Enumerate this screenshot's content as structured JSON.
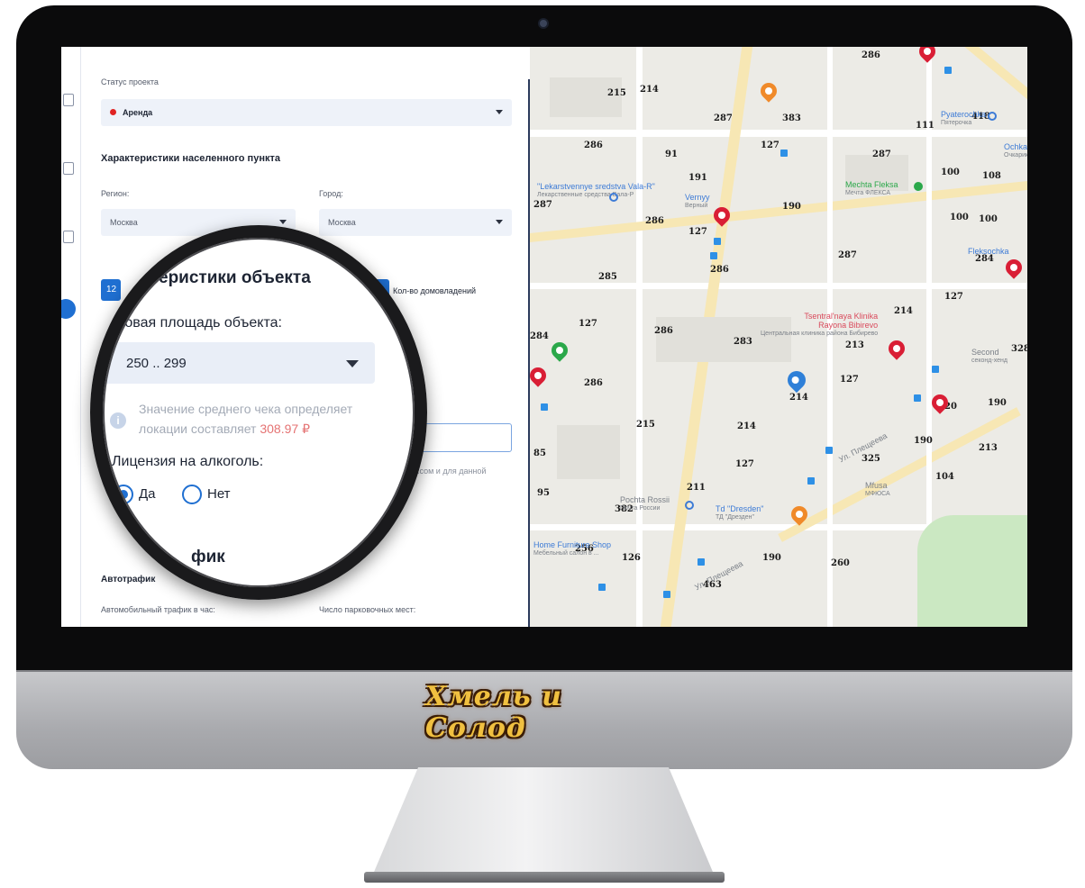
{
  "brand": {
    "logo_text": "Хмель и Солод"
  },
  "form": {
    "status_label": "Статус проекта",
    "status_value": "Аренда",
    "locality_heading": "Характеристики населенного пункта",
    "region_label": "Регион:",
    "city_label": "Город:",
    "region_value": "Москва",
    "city_value": "Москва",
    "chip_left": "12",
    "chip_right": "10",
    "households_label": "Кол-во домовладений",
    "hint_fragment": "ассом и для данной",
    "autotraffic_heading": "Автотрафик",
    "auto_per_hour_label": "Автомобильный трафик в час:",
    "parking_label": "Число парковочных мест:"
  },
  "magnifier": {
    "heading": "еристики объекта",
    "area_label": "рговая площадь объекта:",
    "area_value": "250 .. 299",
    "info_line1": "Значение среднего чека определяет",
    "info_line2": "локации составляет",
    "avg_check": "308.97 ₽",
    "alcohol_label": "Лицензия на алкоголь:",
    "yes_label": "Да",
    "no_label": "Нет",
    "traffic_fragment": "фик"
  },
  "map": {
    "numbers": [
      "286",
      "215",
      "214",
      "287",
      "383",
      "111",
      "418",
      "286",
      "91",
      "127",
      "287",
      "100",
      "108",
      "191",
      "287",
      "190",
      "100",
      "100",
      "286",
      "127",
      "286",
      "287",
      "284",
      "285",
      "127",
      "214",
      "127",
      "286",
      "283",
      "213",
      "328",
      "284",
      "286",
      "214",
      "127",
      "20",
      "190",
      "215",
      "214",
      "190",
      "213",
      "325",
      "127",
      "104",
      "85",
      "211",
      "95",
      "382",
      "256",
      "126",
      "190",
      "260",
      "463"
    ],
    "places": {
      "pyaterochka": "Pyaterochka",
      "pyaterochka_sub": "Пятерочка",
      "ochkarik": "Ochkarik",
      "ochkarik_sub": "Очкарик",
      "mechta": "Mechta Fleksa",
      "mechta_sub": "Мечта ФЛЕКСА",
      "lekarstvennye": "\"Lekarstvennye",
      "lekarstvennye_2": "sredstva Vala-R\"",
      "lekarstvennye_sub": "Лекарственные средства Вала-Р",
      "vernyy": "Vernyy",
      "vernyy_sub": "Верный",
      "fleksochka": "Fleksochka",
      "klinika": "Tsentral'naya Klinika",
      "klinika_2": "Rayona Bibirevo",
      "klinika_sub": "Центральная клиника района Бибирево",
      "second": "Second",
      "second_sub": "секонд-хенд",
      "pochta": "Pochta Rossii",
      "pochta_sub": "Почта России",
      "dresden": "Td \"Dresden\"",
      "dresden_sub": "ТД \"Дрезден\"",
      "mfusa": "Mfusa",
      "mfusa_sub": "МФЮСА",
      "home_furniture": "Home Furniture Shop",
      "home_furniture_sub": "Мебельный салон в ...",
      "street1": "Ул. Плещеева",
      "street2": "Ул. Плещеева"
    }
  },
  "colors": {
    "accent": "#1f6fd1",
    "status_dot": "#e02323",
    "avg_check": "#e57373",
    "pin_red": "#d91e35"
  }
}
